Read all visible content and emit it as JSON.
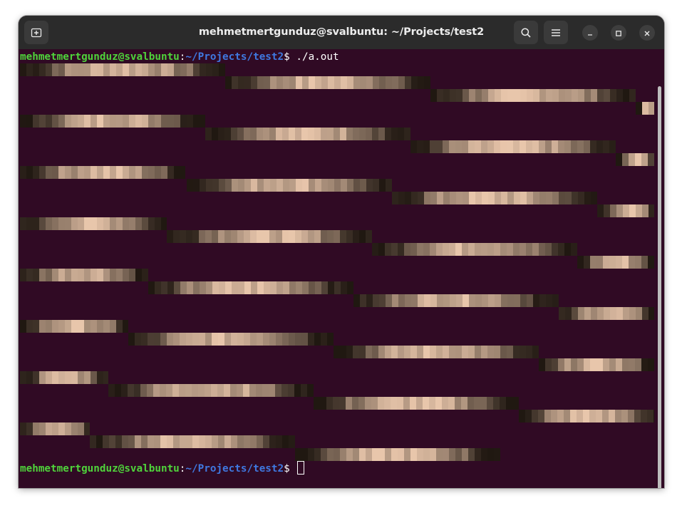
{
  "window": {
    "title": "mehmetmertgunduz@svalbuntu: ~/Projects/test2",
    "buttons": {
      "new_tab": "new-tab-icon",
      "search": "search-icon",
      "menu": "hamburger-menu-icon",
      "minimize": "minimize-icon",
      "maximize": "maximize-icon",
      "close": "close-icon"
    }
  },
  "terminal": {
    "prompt_user": "mehmetmertgunduz@svalbuntu",
    "prompt_sep": ":",
    "prompt_path": "~/Projects/test2",
    "prompt_sign": "$ ",
    "command": "./a.out",
    "colors": {
      "background": "#300a24",
      "user": "#4fd33b",
      "path": "#3f78e0",
      "text": "#ffffff"
    },
    "output_art": "pixelated photographic image rendered as colored blocks in staggered diagonal rows"
  }
}
